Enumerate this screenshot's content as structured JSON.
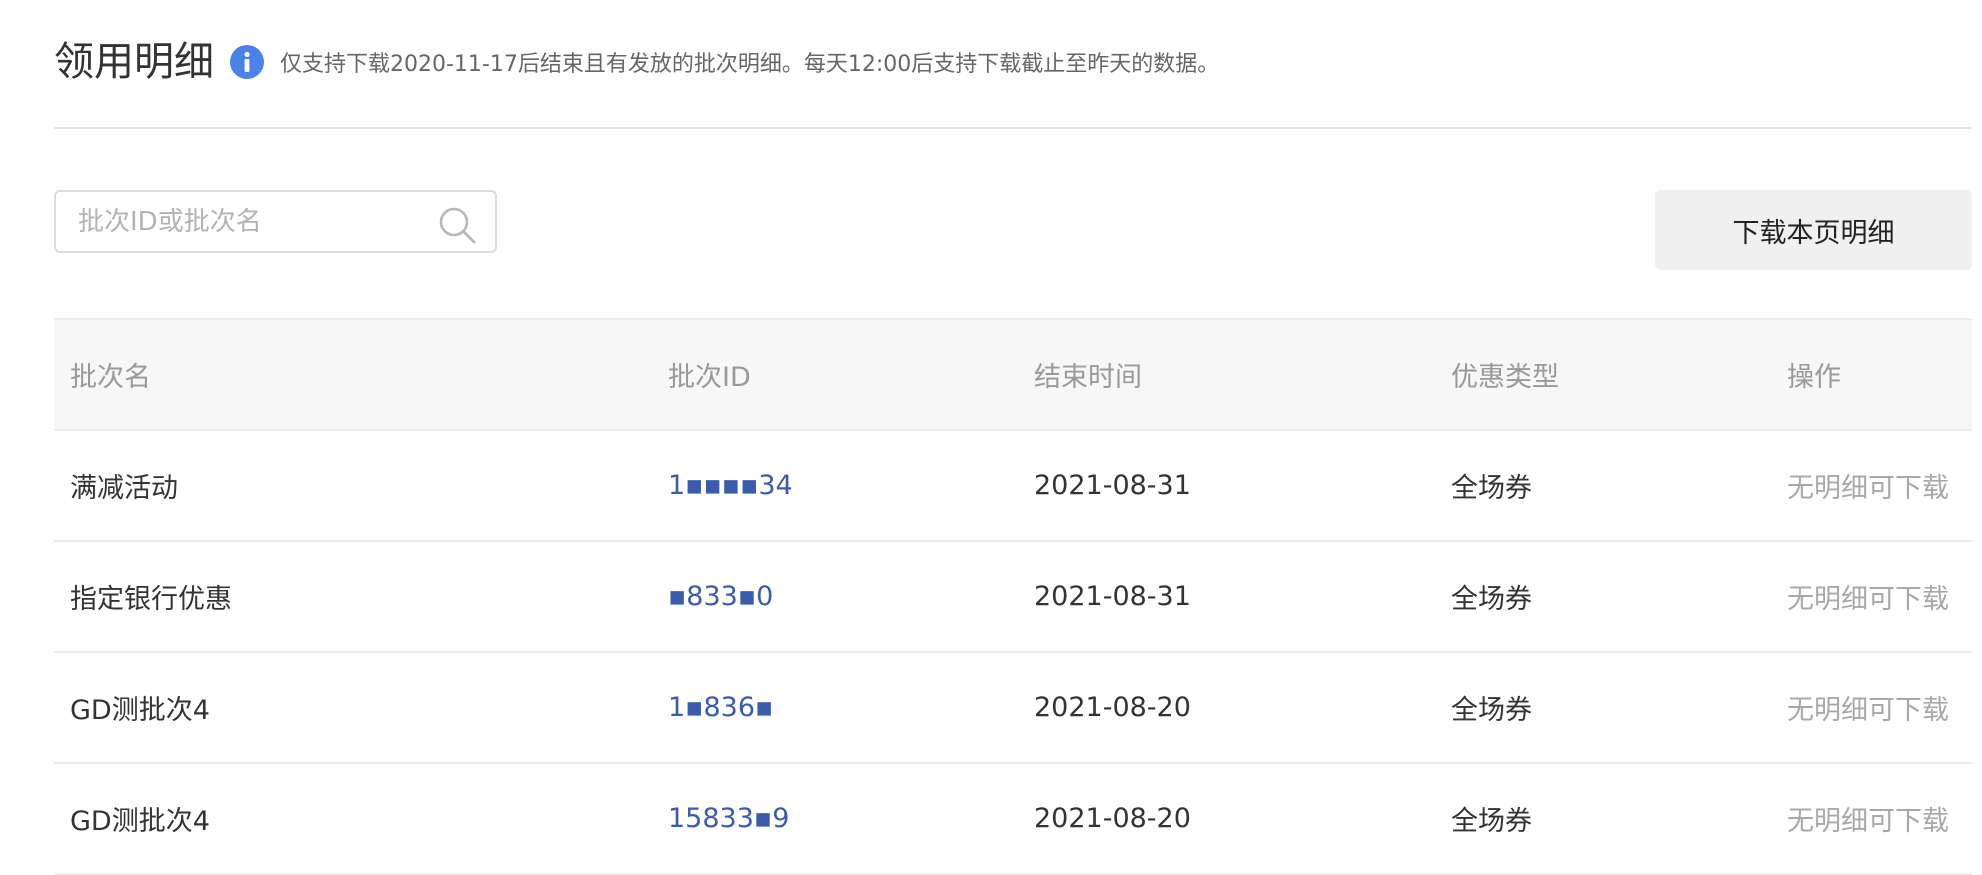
{
  "header": {
    "title": "领用明细",
    "notice": "仅支持下载2020-11-17后结束且有发放的批次明细。每天12:00后支持下载截止至昨天的数据。"
  },
  "search": {
    "placeholder": "批次ID或批次名",
    "value": ""
  },
  "toolbar": {
    "download_label": "下载本页明细"
  },
  "table": {
    "columns": [
      "批次名",
      "批次ID",
      "结束时间",
      "优惠类型",
      "操作"
    ],
    "rows": [
      {
        "name": "满减活动",
        "id": "1▪▪▪▪34",
        "end_time": "2021-08-31",
        "type": "全场券",
        "action": "无明细可下载"
      },
      {
        "name": "指定银行优惠",
        "id": "▪833▪0",
        "end_time": "2021-08-31",
        "type": "全场券",
        "action": "无明细可下载"
      },
      {
        "name": "GD测批次4",
        "id": "1▪836▪",
        "end_time": "2021-08-20",
        "type": "全场券",
        "action": "无明细可下载"
      },
      {
        "name": "GD测批次4",
        "id": "15833▪9",
        "end_time": "2021-08-20",
        "type": "全场券",
        "action": "无明细可下载"
      }
    ]
  },
  "colors": {
    "accent": "#4a82e8",
    "link": "#3b5bad",
    "muted": "#a8a8a8"
  },
  "icons": {
    "info": "info-icon",
    "search": "search-icon"
  }
}
